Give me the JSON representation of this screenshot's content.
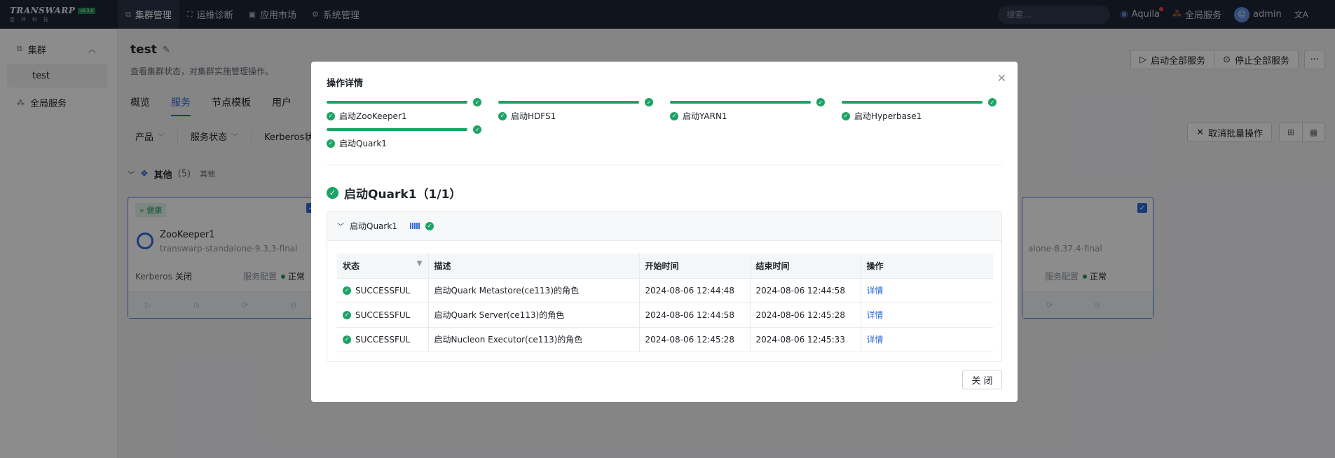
{
  "logo": {
    "text": "TRANSWARP",
    "badge": "v9.3.6",
    "sub": "星环科技"
  },
  "nav": [
    {
      "label": "集群管理",
      "icon": "⧉",
      "active": true
    },
    {
      "label": "运维诊断",
      "icon": "⛶"
    },
    {
      "label": "应用市场",
      "icon": "▣"
    },
    {
      "label": "系统管理",
      "icon": "⚙"
    }
  ],
  "topbar": {
    "search_placeholder": "搜索...",
    "aquila": "Aquila",
    "global_service": "全局服务",
    "user": "admin"
  },
  "sidebar": {
    "group_label": "集群",
    "sub_item": "test",
    "global_service": "全局服务"
  },
  "page": {
    "title": "test",
    "desc": "查看集群状态，对集群实施管理操作。",
    "start_all": "启动全部服务",
    "stop_all": "停止全部服务",
    "more": "···"
  },
  "tabs": [
    "概览",
    "服务",
    "节点模板",
    "用户"
  ],
  "filters": [
    "产品",
    "服务状态",
    "Kerberos状"
  ],
  "cancel_batch": "取消批量操作",
  "group": {
    "name": "其他",
    "count": "(5)",
    "tag": "其他"
  },
  "cards": {
    "left": {
      "health": "健康",
      "name": "ZooKeeper1",
      "version": "transwarp-standalone-9.3.3-final",
      "kerberos_label": "Kerberos",
      "kerberos_value": "关闭",
      "config_label": "服务配置",
      "config_value": "正常"
    },
    "right": {
      "version": "alone-8.37.4-final",
      "config_label": "服务配置",
      "config_value": "正常"
    }
  },
  "modal": {
    "title": "操作详情",
    "steps": [
      "启动ZooKeeper1",
      "启动HDFS1",
      "启动YARN1",
      "启动Hyperbase1",
      "启动Quark1"
    ],
    "section_title": "启动Quark1（1/1）",
    "panel_title": "启动Quark1",
    "table": {
      "headers": [
        "状态",
        "描述",
        "开始时间",
        "结束时间",
        "操作"
      ],
      "rows": [
        [
          "SUCCESSFUL",
          "启动Quark Metastore(ce113)的角色",
          "2024-08-06 12:44:48",
          "2024-08-06 12:44:58",
          "详情"
        ],
        [
          "SUCCESSFUL",
          "启动Quark Server(ce113)的角色",
          "2024-08-06 12:44:58",
          "2024-08-06 12:45:28",
          "详情"
        ],
        [
          "SUCCESSFUL",
          "启动Nucleon Executor(ce113)的角色",
          "2024-08-06 12:45:28",
          "2024-08-06 12:45:33",
          "详情"
        ]
      ]
    },
    "close_label": "关 闭"
  }
}
